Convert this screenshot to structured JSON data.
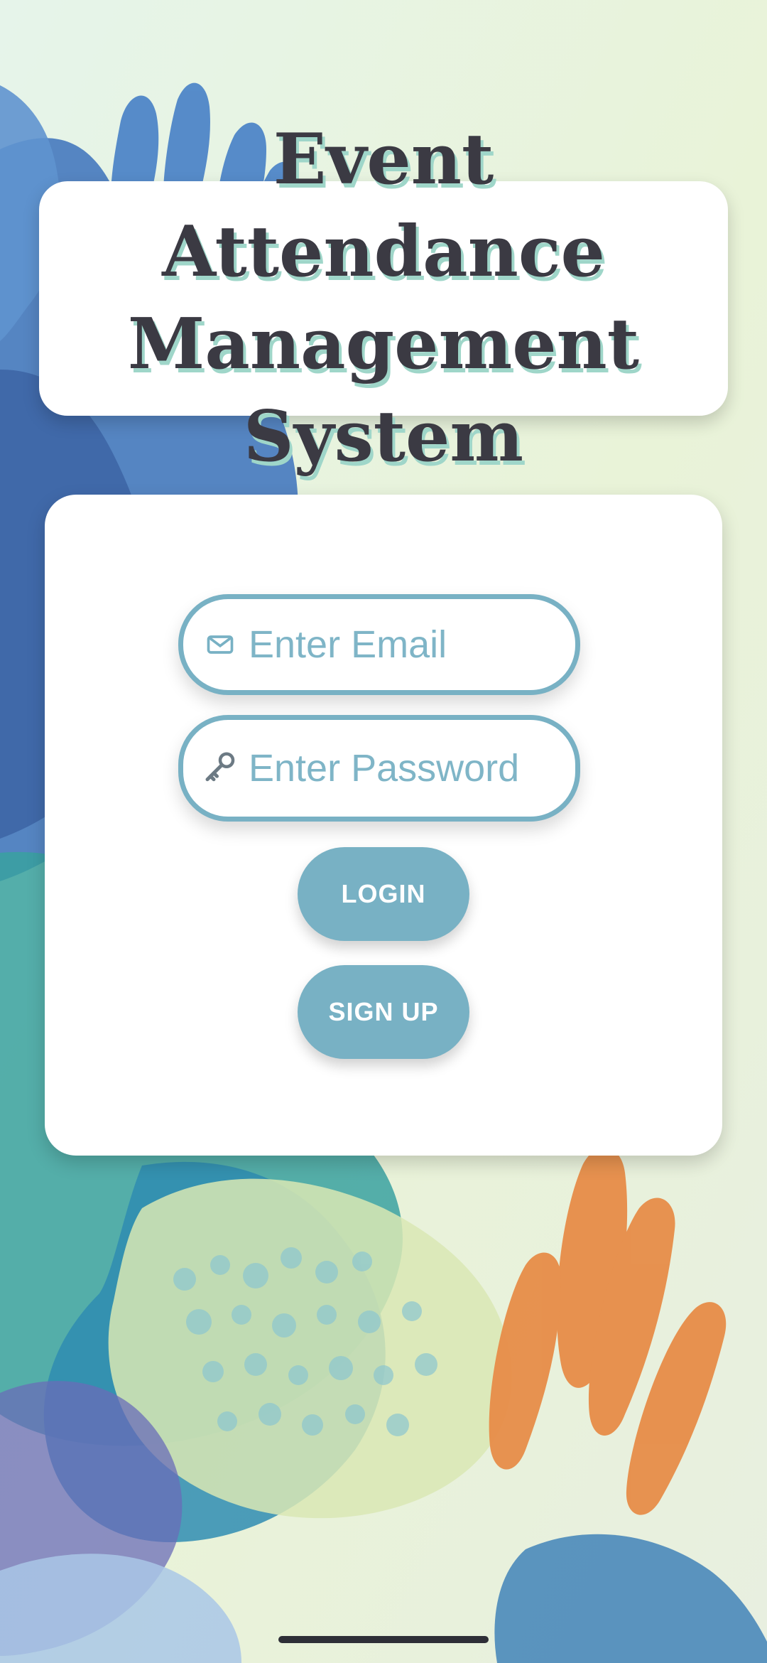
{
  "header": {
    "title_line1": "Event Attendance",
    "title_line2": "Management System"
  },
  "form": {
    "email": {
      "placeholder": "Enter Email",
      "icon": "envelope-icon"
    },
    "password": {
      "placeholder": "Enter Password",
      "icon": "key-icon"
    },
    "login_label": "LOGIN",
    "signup_label": "SIGN UP"
  },
  "colors": {
    "accent": "#78b1c4",
    "title_text": "#3b3a43",
    "title_shadow": "#9fd6c9",
    "card_bg": "#ffffff"
  }
}
